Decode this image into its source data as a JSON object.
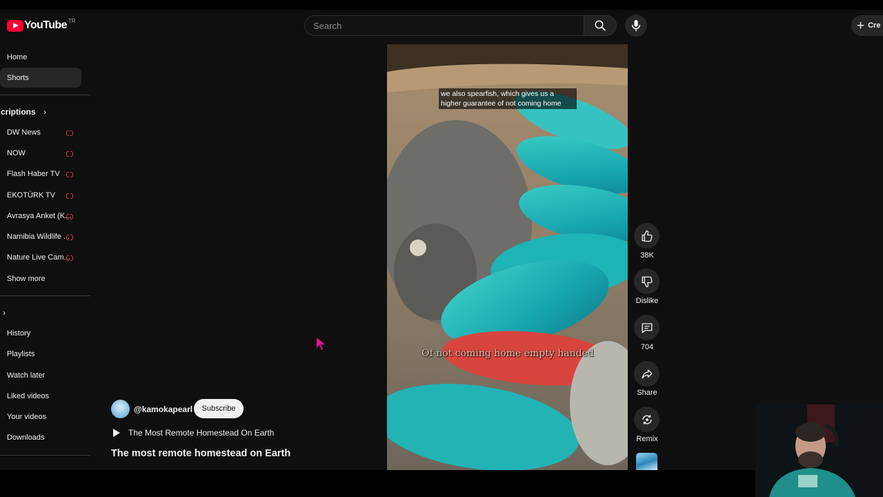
{
  "header": {
    "logo_text": "YouTube",
    "logo_country": "TR",
    "search_placeholder": "Search",
    "create_label": "Cre"
  },
  "sidebar": {
    "home": "Home",
    "shorts": "Shorts",
    "subscriptions_title": "criptions",
    "subscriptions": [
      {
        "label": "DW News",
        "live": true
      },
      {
        "label": "NOW",
        "live": true
      },
      {
        "label": "Flash Haber TV",
        "live": true
      },
      {
        "label": "EKOTÜRK TV",
        "live": true
      },
      {
        "label": "Avrasya Anket (K...",
        "live": true
      },
      {
        "label": "Namibia Wildlife ...",
        "live": true
      },
      {
        "label": "Nature Live Cam...",
        "live": true
      }
    ],
    "show_more": "Show more",
    "you_items": [
      "History",
      "Playlists",
      "Watch later",
      "Liked videos",
      "Your videos",
      "Downloads"
    ]
  },
  "short": {
    "caption_top": "we also spearfish, which gives us a higher guarantee of not coming home",
    "caption_burned": "Of not coming home empty handed",
    "channel": "@kamokapearl",
    "subscribe_label": "Subscribe",
    "playlist_title": "The Most Remote Homestead On Earth",
    "video_title": "The most remote homestead on Earth"
  },
  "actions": {
    "like_count": "38K",
    "dislike_label": "Dislike",
    "comments_count": "704",
    "share_label": "Share",
    "remix_label": "Remix"
  },
  "colors": {
    "background": "#0f0f0f",
    "brand_red": "#ff0033",
    "live_red": "#d63b4a",
    "chip": "#272727"
  }
}
